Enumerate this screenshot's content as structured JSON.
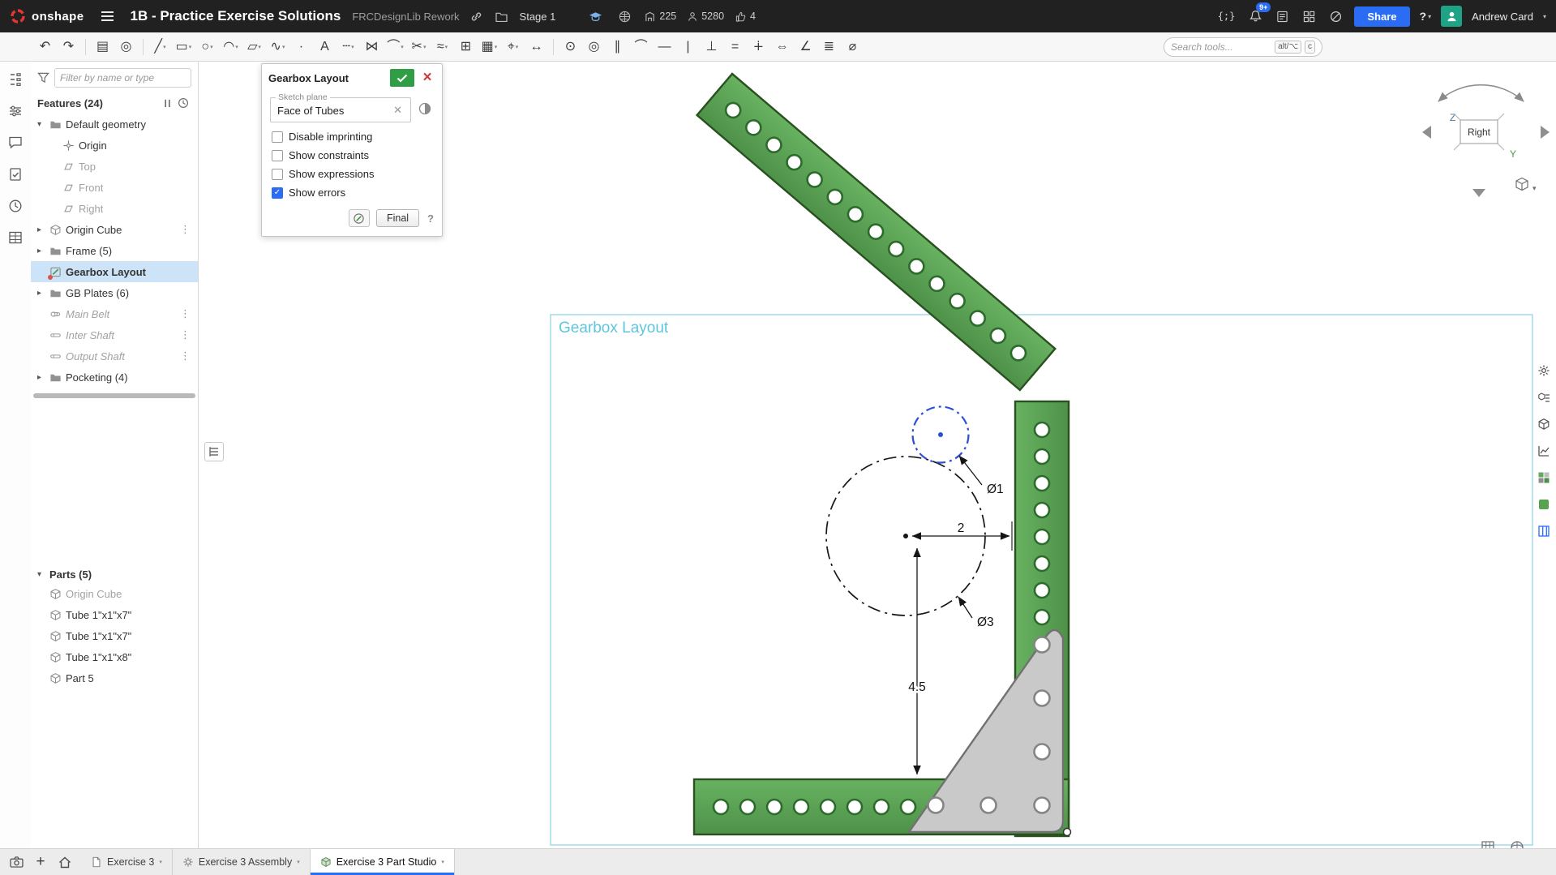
{
  "topbar": {
    "brand": "onshape",
    "title": "1B - Practice Exercise Solutions",
    "subtitle": "FRCDesignLib Rework",
    "location": "Stage 1",
    "copies": "225",
    "views": "5280",
    "likes": "4",
    "share_label": "Share",
    "notification_badge": "9+",
    "help_label": "?",
    "user_name": "Andrew Card"
  },
  "toolbar": {
    "search_placeholder": "Search tools...",
    "shortcut_key1": "alt/⌥",
    "shortcut_key2": "c",
    "tools": [
      {
        "name": "undo",
        "glyph": "↶"
      },
      {
        "name": "redo",
        "glyph": "↷"
      },
      {
        "divider": true
      },
      {
        "name": "paste-sketch",
        "glyph": "▤"
      },
      {
        "name": "insert-dxf",
        "glyph": "◎"
      },
      {
        "divider": true
      },
      {
        "name": "line",
        "glyph": "╱",
        "caret": true
      },
      {
        "name": "corner-rectangle",
        "glyph": "▭",
        "caret": true
      },
      {
        "name": "center-circle",
        "glyph": "○",
        "caret": true
      },
      {
        "name": "arc",
        "glyph": "◠",
        "caret": true
      },
      {
        "name": "slot",
        "glyph": "▱",
        "caret": true
      },
      {
        "name": "spline",
        "glyph": "∿",
        "caret": true
      },
      {
        "name": "point",
        "glyph": "∙"
      },
      {
        "name": "text",
        "glyph": "A"
      },
      {
        "name": "construction",
        "glyph": "┄",
        "caret": true
      },
      {
        "name": "mirror",
        "glyph": "⋈"
      },
      {
        "name": "fillet",
        "glyph": "⌒",
        "caret": true
      },
      {
        "name": "trim",
        "glyph": "✂",
        "caret": true
      },
      {
        "name": "offset",
        "glyph": "≈",
        "caret": true
      },
      {
        "name": "use-project",
        "glyph": "⊞"
      },
      {
        "name": "pattern",
        "glyph": "▦",
        "caret": true
      },
      {
        "name": "transform",
        "glyph": "⌖",
        "caret": true
      },
      {
        "name": "dimension",
        "glyph": "↔"
      },
      {
        "divider": true
      },
      {
        "name": "coincident-constraint",
        "glyph": "⊙"
      },
      {
        "name": "concentric-constraint",
        "glyph": "◎"
      },
      {
        "name": "parallel-constraint",
        "glyph": "∥"
      },
      {
        "name": "tangent-constraint",
        "glyph": "⌒"
      },
      {
        "name": "horizontal-constraint",
        "glyph": "―"
      },
      {
        "name": "vertical-constraint",
        "glyph": "|"
      },
      {
        "name": "perpendicular-constraint",
        "glyph": "⊥"
      },
      {
        "name": "equal-constraint",
        "glyph": "="
      },
      {
        "name": "midpoint-constraint",
        "glyph": "∔"
      },
      {
        "name": "symmetric-constraint",
        "glyph": "⇔"
      },
      {
        "name": "angle-constraint",
        "glyph": "∠"
      },
      {
        "name": "curve-pattern",
        "glyph": "≣"
      },
      {
        "name": "measure",
        "glyph": "⌀"
      }
    ]
  },
  "left_panel": {
    "filter_placeholder": "Filter by name or type",
    "features_title": "Features (24)",
    "parts_title": "Parts (5)",
    "features": [
      {
        "label": "Default geometry",
        "icon": "folder",
        "caret": "open"
      },
      {
        "label": "Origin",
        "icon": "origin",
        "indent": 1
      },
      {
        "label": "Top",
        "icon": "plane",
        "indent": 1,
        "dimmed": true
      },
      {
        "label": "Front",
        "icon": "plane",
        "indent": 1,
        "dimmed": true
      },
      {
        "label": "Right",
        "icon": "plane",
        "indent": 1,
        "dimmed": true
      },
      {
        "label": "Origin Cube",
        "icon": "cube",
        "caret": "closed",
        "dots": true
      },
      {
        "label": "Frame (5)",
        "icon": "folder",
        "caret": "closed"
      },
      {
        "label": "Gearbox Layout",
        "icon": "sketch",
        "selected": true,
        "editing": true
      },
      {
        "label": "GB Plates (6)",
        "icon": "folder",
        "caret": "closed"
      },
      {
        "label": "Main Belt",
        "icon": "belt",
        "dimmed": true,
        "italic": true,
        "dots": true
      },
      {
        "label": "Inter Shaft",
        "icon": "shaft",
        "dimmed": true,
        "italic": true,
        "dots": true
      },
      {
        "label": "Output Shaft",
        "icon": "shaft",
        "dimmed": true,
        "italic": true,
        "dots": true
      },
      {
        "label": "Pocketing (4)",
        "icon": "folder",
        "caret": "closed"
      }
    ],
    "parts": [
      {
        "label": "Origin Cube",
        "dimmed": true
      },
      {
        "label": "Tube 1\"x1\"x7\""
      },
      {
        "label": "Tube 1\"x1\"x7\""
      },
      {
        "label": "Tube 1\"x1\"x8\""
      },
      {
        "label": "Part 5"
      }
    ]
  },
  "dialog": {
    "title": "Gearbox Layout",
    "plane_label": "Sketch plane",
    "plane_value": "Face of Tubes",
    "options": [
      {
        "label": "Disable imprinting",
        "checked": false
      },
      {
        "label": "Show constraints",
        "checked": false
      },
      {
        "label": "Show expressions",
        "checked": false
      },
      {
        "label": "Show errors",
        "checked": true
      }
    ],
    "final_label": "Final"
  },
  "canvas": {
    "sketch_name": "Gearbox Layout",
    "dims": {
      "diameter_small": "Ø1",
      "diameter_large": "Ø3",
      "center_offset": "2",
      "height_offset": "4.5"
    },
    "colors": {
      "tube_green": "#5aa35a",
      "tube_edge": "#28511f",
      "hole_ring": "#2d6b2d",
      "gusset_gray": "#c9c9c9",
      "gusset_edge": "#717171",
      "selected_blue": "#2b50d4",
      "boundary_cyan": "#9fdbe8",
      "label_cyan": "#5ec6dc"
    }
  },
  "viewcube": {
    "face": "Right",
    "axis_z": "Z",
    "axis_y": "Y"
  },
  "bottombar": {
    "tabs": [
      {
        "label": "Exercise 3",
        "icon": "doc"
      },
      {
        "label": "Exercise 3 Assembly",
        "icon": "assembly"
      },
      {
        "label": "Exercise 3 Part Studio",
        "icon": "partstudio",
        "active": true
      }
    ]
  },
  "icons": {
    "topbar": [
      "onshape-logo",
      "menu-icon",
      "link-icon",
      "folder-icon",
      "education-icon",
      "globe-icon",
      "building-icon",
      "person-icon",
      "thumbs-up-icon",
      "featurescript-icon",
      "bell-icon",
      "notes-icon",
      "apps-icon",
      "offline-icon",
      "help-icon",
      "avatar",
      "caret-down-icon"
    ],
    "left_strip": [
      "feature-list-icon",
      "configurations-icon",
      "comments-icon",
      "clipboard-check-icon",
      "history-clock-icon",
      "tables-grid-icon"
    ],
    "right_rail": [
      "gear-icon",
      "cube-list-icon",
      "cube-icon",
      "chart-icon",
      "palette-icon",
      "material-icon",
      "table-columns-icon"
    ],
    "canvas_corner": [
      "sketch-grid-icon",
      "shaded-sphere-icon"
    ],
    "bottom_left": [
      "camera-icon",
      "add-tab-icon",
      "home-icon"
    ]
  }
}
